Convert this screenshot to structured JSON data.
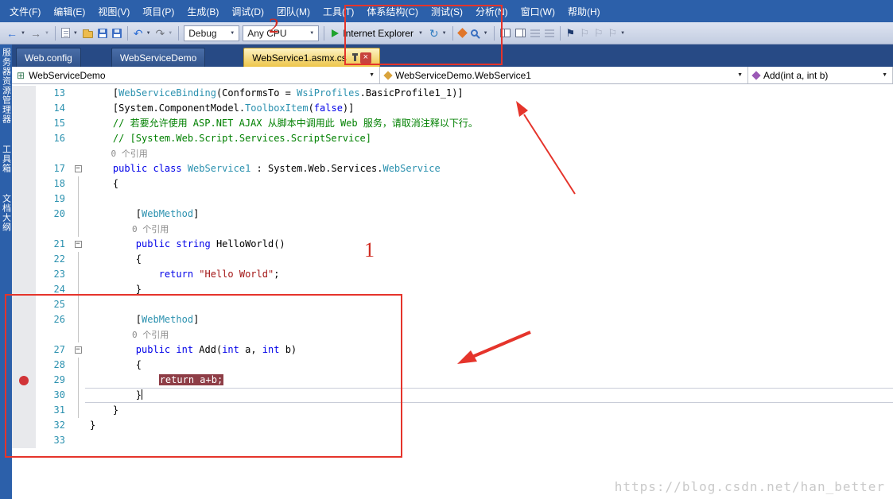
{
  "menu": {
    "items": [
      "文件(F)",
      "编辑(E)",
      "视图(V)",
      "项目(P)",
      "生成(B)",
      "调试(D)",
      "团队(M)",
      "工具(T)",
      "体系结构(C)",
      "测试(S)",
      "分析(N)",
      "窗口(W)",
      "帮助(H)"
    ]
  },
  "toolbar": {
    "debug_label": "Debug",
    "platform_label": "Any CPU",
    "browser_label": "Internet Explorer"
  },
  "tabs": [
    {
      "label": "Web.config",
      "active": false
    },
    {
      "label": "WebServiceDemo",
      "active": false
    },
    {
      "label": "WebService1.asmx.cs",
      "active": true
    }
  ],
  "navbar": {
    "project": "WebServiceDemo",
    "type": "WebServiceDemo.WebService1",
    "member": "Add(int a, int b)"
  },
  "side_tabs": [
    "服务器资源管理器",
    "工具箱",
    "文档大纲"
  ],
  "annotations": {
    "label_1": "1",
    "label_2": "2"
  },
  "watermark": "https://blog.csdn.net/han_better",
  "editor": {
    "rows": [
      {
        "ln": "13",
        "segs": [
          [
            "p",
            "    ["
          ],
          [
            "t",
            "WebServiceBinding"
          ],
          [
            "p",
            "(ConformsTo = "
          ],
          [
            "t",
            "WsiProfiles"
          ],
          [
            "p",
            ".BasicProfile1_1)]"
          ]
        ]
      },
      {
        "ln": "14",
        "segs": [
          [
            "p",
            "    [System.ComponentModel."
          ],
          [
            "t",
            "ToolboxItem"
          ],
          [
            "p",
            "("
          ],
          [
            "k",
            "false"
          ],
          [
            "p",
            ")]"
          ]
        ]
      },
      {
        "ln": "15",
        "segs": [
          [
            "c",
            "    // 若要允许使用 ASP.NET AJAX 从脚本中调用此 Web 服务，请取消注释以下行。"
          ]
        ]
      },
      {
        "ln": "16",
        "segs": [
          [
            "c",
            "    // [System.Web.Script.Services.ScriptService]"
          ]
        ]
      },
      {
        "ln": "",
        "segs": [
          [
            "r",
            "    0 个引用"
          ]
        ]
      },
      {
        "ln": "17",
        "collapse": true,
        "segs": [
          [
            "k",
            "    public class "
          ],
          [
            "t",
            "WebService1"
          ],
          [
            "p",
            " : System.Web.Services."
          ],
          [
            "t",
            "WebService"
          ]
        ]
      },
      {
        "ln": "18",
        "g": true,
        "segs": [
          [
            "p",
            "    {"
          ]
        ]
      },
      {
        "ln": "19",
        "g": true,
        "segs": []
      },
      {
        "ln": "20",
        "g": true,
        "segs": [
          [
            "p",
            "        ["
          ],
          [
            "t",
            "WebMethod"
          ],
          [
            "p",
            "]"
          ]
        ]
      },
      {
        "ln": "",
        "g": true,
        "segs": [
          [
            "r",
            "        0 个引用"
          ]
        ]
      },
      {
        "ln": "21",
        "collapse": true,
        "segs": [
          [
            "k",
            "        public string "
          ],
          [
            "p",
            "HelloWorld()"
          ]
        ]
      },
      {
        "ln": "22",
        "g": true,
        "segs": [
          [
            "p",
            "        {"
          ]
        ]
      },
      {
        "ln": "23",
        "g": true,
        "segs": [
          [
            "k",
            "            return "
          ],
          [
            "s",
            "\"Hello World\""
          ],
          [
            "p",
            ";"
          ]
        ]
      },
      {
        "ln": "24",
        "g": true,
        "segs": [
          [
            "p",
            "        }"
          ]
        ]
      },
      {
        "ln": "25",
        "g": true,
        "segs": []
      },
      {
        "ln": "26",
        "g": true,
        "segs": [
          [
            "p",
            "        ["
          ],
          [
            "t",
            "WebMethod"
          ],
          [
            "p",
            "]"
          ]
        ]
      },
      {
        "ln": "",
        "g": true,
        "segs": [
          [
            "r",
            "        0 个引用"
          ]
        ]
      },
      {
        "ln": "27",
        "collapse": true,
        "segs": [
          [
            "k",
            "        public int "
          ],
          [
            "p",
            "Add("
          ],
          [
            "k",
            "int"
          ],
          [
            "p",
            " a, "
          ],
          [
            "k",
            "int"
          ],
          [
            "p",
            " b)"
          ]
        ]
      },
      {
        "ln": "28",
        "g": true,
        "segs": [
          [
            "p",
            "        {"
          ]
        ]
      },
      {
        "ln": "29",
        "g": true,
        "bp": true,
        "segs": [
          [
            "p",
            "            "
          ],
          [
            "h",
            "return a+b;"
          ]
        ]
      },
      {
        "ln": "30",
        "g": true,
        "cur": true,
        "caret": true,
        "segs": [
          [
            "p",
            "        }"
          ]
        ]
      },
      {
        "ln": "31",
        "g": true,
        "segs": [
          [
            "p",
            "    }"
          ]
        ]
      },
      {
        "ln": "32",
        "segs": [
          [
            "p",
            "}"
          ]
        ]
      },
      {
        "ln": "33",
        "segs": []
      }
    ]
  }
}
